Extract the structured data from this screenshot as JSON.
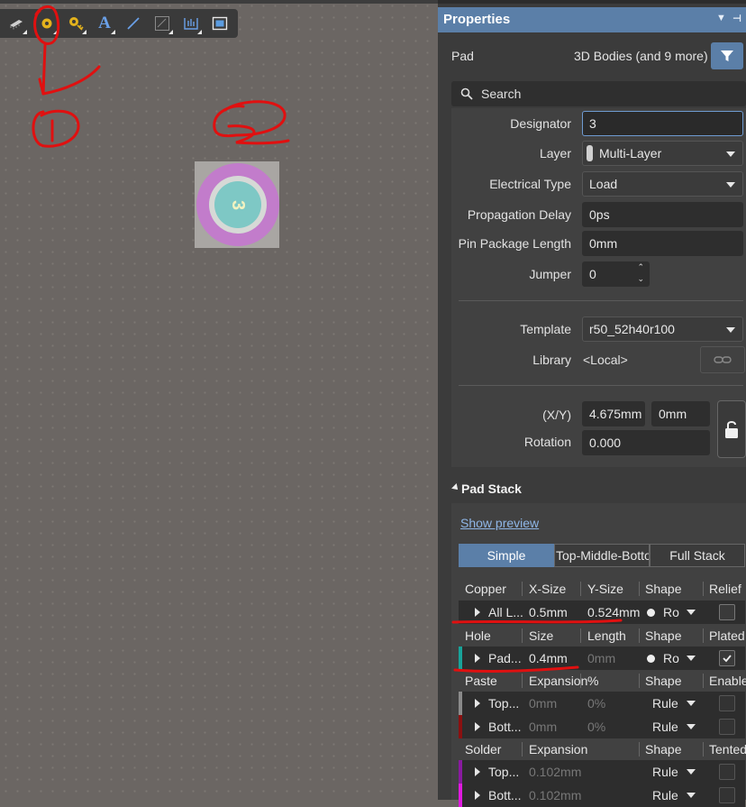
{
  "canvas": {
    "pad_designator": "3",
    "annotations": [
      "1",
      "2"
    ],
    "toolbar": [
      {
        "icon": "component-icon"
      },
      {
        "icon": "pad-icon"
      },
      {
        "icon": "via-icon"
      },
      {
        "icon": "text-icon",
        "glyph": "A"
      },
      {
        "icon": "line-icon"
      },
      {
        "icon": "dimension-icon"
      },
      {
        "icon": "array-icon"
      },
      {
        "icon": "region-icon"
      }
    ]
  },
  "panel": {
    "title": "Properties",
    "object_type": "Pad",
    "filter_text": "3D Bodies (and 9 more)",
    "search_placeholder": "Search",
    "fields": {
      "designator_label": "Designator",
      "designator": "3",
      "layer_label": "Layer",
      "layer": "Multi-Layer",
      "electrical_type_label": "Electrical Type",
      "electrical_type": "Load",
      "propagation_delay_label": "Propagation Delay",
      "propagation_delay": "0ps",
      "pin_package_length_label": "Pin Package Length",
      "pin_package_length": "0mm",
      "jumper_label": "Jumper",
      "jumper": "0",
      "template_label": "Template",
      "template": "r50_52h40r100",
      "library_label": "Library",
      "library": "<Local>",
      "xy_label": "(X/Y)",
      "x": "4.675mm",
      "y": "0mm",
      "rotation_label": "Rotation",
      "rotation": "0.000"
    },
    "pad_stack": {
      "title": "Pad Stack",
      "show_preview": "Show preview",
      "tabs": [
        "Simple",
        "Top-Middle-Bottom",
        "Full Stack"
      ],
      "copper": {
        "headers": [
          "Copper",
          "X-Size",
          "Y-Size",
          "Shape",
          "Relief"
        ],
        "rows": [
          {
            "name": "All L...",
            "x": "0.5mm",
            "y": "0.524mm",
            "shape": "Ro"
          }
        ]
      },
      "hole": {
        "headers": [
          "Hole",
          "Size",
          "Length",
          "Shape",
          "Plated"
        ],
        "rows": [
          {
            "name": "Pad...",
            "size": "0.4mm",
            "length": "0mm",
            "shape": "Ro",
            "color": "#18a39a"
          }
        ]
      },
      "paste": {
        "headers": [
          "Paste",
          "Expansion",
          "%",
          "Shape",
          "Enabled"
        ],
        "rows": [
          {
            "name": "Top...",
            "exp": "0mm",
            "pct": "0%",
            "shape": "Rule",
            "color": "#8a8a8a"
          },
          {
            "name": "Bott...",
            "exp": "0mm",
            "pct": "0%",
            "shape": "Rule",
            "color": "#8b1010"
          }
        ]
      },
      "solder": {
        "headers": [
          "Solder",
          "Expansion",
          "Shape",
          "Tented"
        ],
        "rows": [
          {
            "name": "Top...",
            "exp": "0.102mm",
            "shape": "Rule",
            "color": "#8a1aa0"
          },
          {
            "name": "Bott...",
            "exp": "0.102mm",
            "shape": "Rule",
            "color": "#e01ae0"
          }
        ]
      }
    }
  }
}
